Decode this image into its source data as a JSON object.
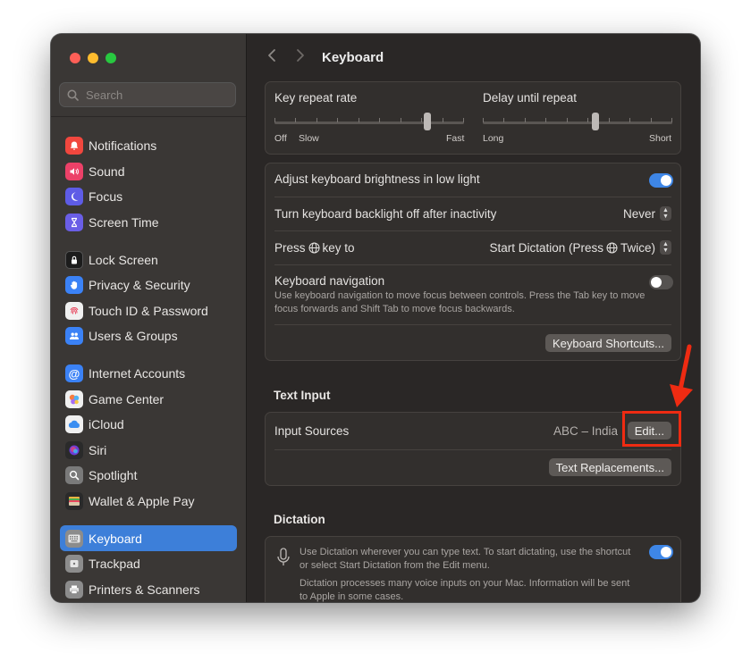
{
  "sidebar": {
    "search_placeholder": "Search",
    "items": [
      {
        "label": "Notifications",
        "icon": "bell-icon",
        "color": "#f1473e"
      },
      {
        "label": "Sound",
        "icon": "speaker-icon",
        "color": "#ec4168"
      },
      {
        "label": "Focus",
        "icon": "moon-icon",
        "color": "#5e5ce6"
      },
      {
        "label": "Screen Time",
        "icon": "hourglass-icon",
        "color": "#6a5ee6"
      },
      {
        "label": "Lock Screen",
        "icon": "lock-icon",
        "color": "#1c1c1c"
      },
      {
        "label": "Privacy & Security",
        "icon": "hand-icon",
        "color": "#3b82f6"
      },
      {
        "label": "Touch ID & Password",
        "icon": "fingerprint-icon",
        "color": "#f0f0f0"
      },
      {
        "label": "Users & Groups",
        "icon": "users-icon",
        "color": "#3b82f6"
      },
      {
        "label": "Internet Accounts",
        "icon": "at-icon",
        "color": "#3b82f6"
      },
      {
        "label": "Game Center",
        "icon": "game-center-icon",
        "color": "#f0f0f0"
      },
      {
        "label": "iCloud",
        "icon": "cloud-icon",
        "color": "#f0f0f0"
      },
      {
        "label": "Siri",
        "icon": "siri-icon",
        "color": "#2a2a2a"
      },
      {
        "label": "Spotlight",
        "icon": "magnifier-icon",
        "color": "#7a7a7a"
      },
      {
        "label": "Wallet & Apple Pay",
        "icon": "wallet-icon",
        "color": "#2a2a2a"
      },
      {
        "label": "Keyboard",
        "icon": "keyboard-icon",
        "color": "#8c8c8c"
      },
      {
        "label": "Trackpad",
        "icon": "trackpad-icon",
        "color": "#8c8c8c"
      },
      {
        "label": "Printers & Scanners",
        "icon": "printer-icon",
        "color": "#8c8c8c"
      }
    ]
  },
  "header": {
    "title": "Keyboard"
  },
  "repeat": {
    "rate_label": "Key repeat rate",
    "rate_off": "Off",
    "rate_slow": "Slow",
    "rate_fast": "Fast",
    "rate_value": 0.82,
    "delay_label": "Delay until repeat",
    "delay_long": "Long",
    "delay_short": "Short",
    "delay_value": 0.6
  },
  "settings": {
    "brightness_label": "Adjust keyboard brightness in low light",
    "brightness_on": true,
    "backlight_label": "Turn keyboard backlight off after inactivity",
    "backlight_value": "Never",
    "press_prefix": "Press",
    "press_suffix": "key to",
    "press_value_a": "Start Dictation (Press",
    "press_value_b": "Twice)",
    "nav_label": "Keyboard navigation",
    "nav_desc": "Use keyboard navigation to move focus between controls. Press the Tab key to move focus forwards and Shift Tab to move focus backwards.",
    "nav_on": false,
    "shortcuts_button": "Keyboard Shortcuts..."
  },
  "text_input": {
    "section_title": "Text Input",
    "input_sources_label": "Input Sources",
    "input_sources_value": "ABC – India",
    "edit_button": "Edit...",
    "replacements_button": "Text Replacements..."
  },
  "dictation": {
    "section_title": "Dictation",
    "desc": "Use Dictation wherever you can type text. To start dictating, use the shortcut or select Start Dictation from the Edit menu.",
    "privacy": "Dictation processes many voice inputs on your Mac. Information will be sent to Apple in some cases.",
    "on": true
  },
  "colors": {
    "accent": "#3d7fd9",
    "annotation": "#ee2b12"
  }
}
